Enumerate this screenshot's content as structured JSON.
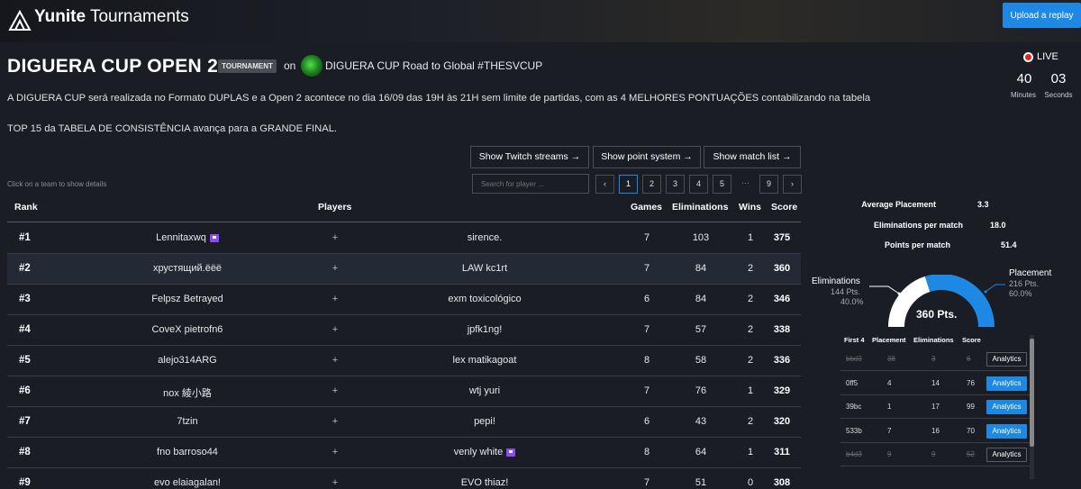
{
  "app": {
    "brand_bold": "Yunite",
    "brand_rest": " Tournaments",
    "upload_label": "Upload a replay"
  },
  "header": {
    "title": "DIGUERA CUP OPEN 2",
    "badge": "TOURNAMENT",
    "on": "on",
    "org_name": "DIGUERA CUP Road to Global #THESVCUP",
    "desc1": "A DIGUERA CUP será realizada no Formato DUPLAS e a Open 2 acontece no dia 16/09 das 19H às 21H sem limite de partidas, com as 4 MELHORES PONTUAÇÕES contabilizando na tabela",
    "desc2": "TOP 15 da TABELA DE CONSISTÊNCIA avança para a GRANDE FINAL."
  },
  "live": {
    "label": "LIVE",
    "minutes": "40",
    "minutes_label": "Minutes",
    "seconds": "03",
    "seconds_label": "Seconds"
  },
  "actions": {
    "twitch": "Show Twitch streams  →",
    "points": "Show point system  →",
    "matches": "Show match list  →"
  },
  "hint": "Click on a team to show details",
  "search": {
    "placeholder": "Search for player ..."
  },
  "pagination": {
    "prev": "‹",
    "pages": [
      "1",
      "2",
      "3",
      "4",
      "5"
    ],
    "dots": "···",
    "last": "9",
    "next": "›",
    "current": "1"
  },
  "table": {
    "headers": {
      "rank": "Rank",
      "players": "Players",
      "games": "Games",
      "elims": "Eliminations",
      "wins": "Wins",
      "score": "Score"
    },
    "rows": [
      {
        "rank": "#1",
        "p1": "Lennitaxwq",
        "plus": "+",
        "p2": "sirence.",
        "games": "7",
        "elims": "103",
        "wins": "1",
        "score": "375"
      },
      {
        "rank": "#2",
        "p1": "хрустящий.ëëë",
        "plus": "+",
        "p2": "LAW kc1rt",
        "games": "7",
        "elims": "84",
        "wins": "2",
        "score": "360"
      },
      {
        "rank": "#3",
        "p1": "Felpsz Betrayed",
        "plus": "+",
        "p2": "exm toxicológico",
        "games": "6",
        "elims": "84",
        "wins": "2",
        "score": "346"
      },
      {
        "rank": "#4",
        "p1": "CoveX pietrofn6",
        "plus": "+",
        "p2": "jpfk1ng!",
        "games": "7",
        "elims": "57",
        "wins": "2",
        "score": "338"
      },
      {
        "rank": "#5",
        "p1": "alejo314ARG",
        "plus": "+",
        "p2": "lex matikagoat",
        "games": "8",
        "elims": "58",
        "wins": "2",
        "score": "336"
      },
      {
        "rank": "#6",
        "p1": "nox 綾小路",
        "plus": "+",
        "p2": "wtj yuri",
        "games": "7",
        "elims": "76",
        "wins": "1",
        "score": "329"
      },
      {
        "rank": "#7",
        "p1": "7tzin",
        "plus": "+",
        "p2": "pepi!",
        "games": "6",
        "elims": "43",
        "wins": "2",
        "score": "320"
      },
      {
        "rank": "#8",
        "p1": "fno barroso44",
        "plus": "+",
        "p2": "venly white",
        "games": "8",
        "elims": "64",
        "wins": "1",
        "score": "311"
      },
      {
        "rank": "#9",
        "p1": "evo elaiagalan!",
        "plus": "+",
        "p2": "EVO thiaz!",
        "games": "7",
        "elims": "51",
        "wins": "0",
        "score": "308"
      }
    ]
  },
  "stats": {
    "avg_placement_label": "Average Placement",
    "avg_placement": "3.3",
    "elims_per_match_label": "Eliminations per match",
    "elims_per_match": "18.0",
    "points_per_match_label": "Points per match",
    "points_per_match": "51.4"
  },
  "gauge": {
    "total": "360 Pts.",
    "elims_label": "Eliminations",
    "elims_pts": "144 Pts.",
    "elims_pct": "40.0%",
    "placement_label": "Placement",
    "placement_pts": "216 Pts.",
    "placement_pct": "60.0%",
    "placement_fraction": 0.6,
    "colors": {
      "elims": "#ffffff",
      "placement": "#1e88e5"
    }
  },
  "detail": {
    "headers": {
      "first4": "First 4",
      "placement": "Placement",
      "elims": "Eliminations",
      "score": "Score"
    },
    "analytics": "Analytics",
    "rows": [
      {
        "id": "bbd3",
        "placement": "38",
        "elims": "3",
        "score": "6",
        "struck": true
      },
      {
        "id": "0ff5",
        "placement": "4",
        "elims": "14",
        "score": "76",
        "struck": false
      },
      {
        "id": "39bc",
        "placement": "1",
        "elims": "17",
        "score": "99",
        "struck": false
      },
      {
        "id": "533b",
        "placement": "7",
        "elims": "16",
        "score": "70",
        "struck": false
      },
      {
        "id": "b4d3",
        "placement": "9",
        "elims": "9",
        "score": "52",
        "struck": true
      }
    ]
  }
}
